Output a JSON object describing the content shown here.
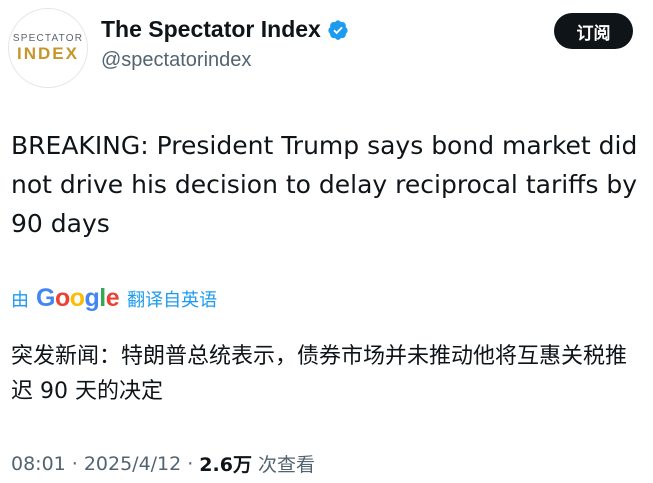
{
  "account": {
    "avatar_line1": "SPECTATOR",
    "avatar_line2": "INDEX",
    "name": "The Spectator Index",
    "handle": "@spectatorindex"
  },
  "actions": {
    "subscribe_label": "订阅"
  },
  "tweet": {
    "text": "BREAKING: President Trump says bond market did not drive his decision to delay reciprocal tariffs by 90 days"
  },
  "translation": {
    "by_label": "由",
    "google_letters": [
      "G",
      "o",
      "o",
      "g",
      "l",
      "e"
    ],
    "translated_from": "翻译自英语",
    "text": "突发新闻：特朗普总统表示，债券市场并未推动他将互惠关税推迟 90 天的决定"
  },
  "meta": {
    "time": "08:01",
    "separator": "·",
    "date": "2025/4/12",
    "views_count": "2.6万",
    "views_label": "次查看"
  },
  "colors": {
    "verified": "#1d9bf0",
    "link": "#1d9bf0",
    "button_bg": "#0f1419"
  }
}
